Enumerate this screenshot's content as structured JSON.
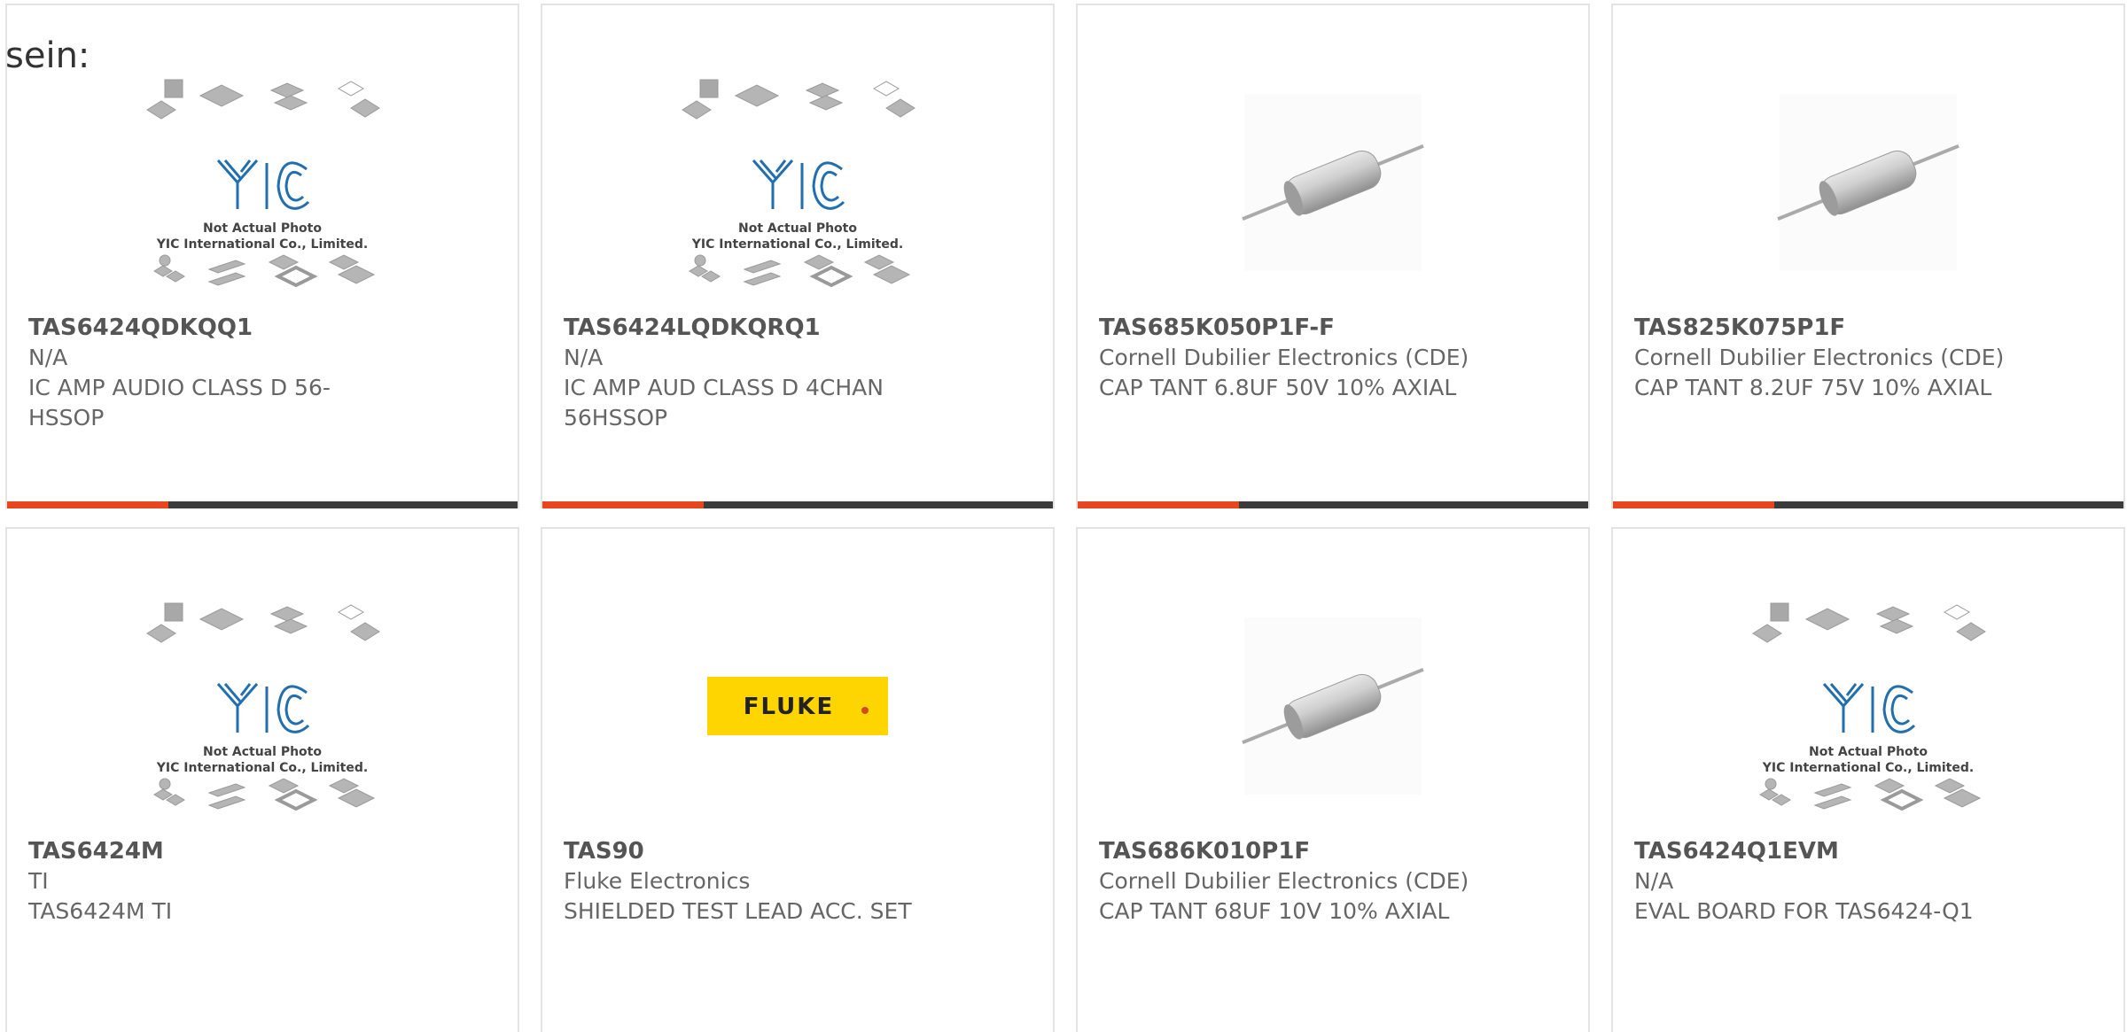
{
  "lead_text": "sein:",
  "placeholder_image": {
    "brand": "YIC",
    "line1": "Not Actual Photo",
    "line2": "YIC International Co., Limited."
  },
  "fluke_logo_text": "FLUKE",
  "products": [
    {
      "part": "TAS6424QDKQQ1",
      "manufacturer": "N/A",
      "description": "IC AMP AUDIO CLASS D 56-HSSOP",
      "image": "yic-placeholder"
    },
    {
      "part": "TAS6424LQDKQRQ1",
      "manufacturer": "N/A",
      "description": "IC AMP AUD CLASS D 4CHAN 56HSSOP",
      "image": "yic-placeholder"
    },
    {
      "part": "TAS685K050P1F-F",
      "manufacturer": "Cornell Dubilier Electronics (CDE)",
      "description": "CAP TANT 6.8UF 50V 10% AXIAL",
      "image": "axial-capacitor"
    },
    {
      "part": "TAS825K075P1F",
      "manufacturer": "Cornell Dubilier Electronics (CDE)",
      "description": "CAP TANT 8.2UF 75V 10% AXIAL",
      "image": "axial-capacitor"
    },
    {
      "part": "TAS6424M",
      "manufacturer": "TI",
      "description": "TAS6424M TI",
      "image": "yic-placeholder"
    },
    {
      "part": "TAS90",
      "manufacturer": "Fluke Electronics",
      "description": "SHIELDED TEST LEAD ACC. SET",
      "image": "fluke-logo"
    },
    {
      "part": "TAS686K010P1F",
      "manufacturer": "Cornell Dubilier Electronics (CDE)",
      "description": "CAP TANT 68UF 10V 10% AXIAL",
      "image": "axial-capacitor"
    },
    {
      "part": "TAS6424Q1EVM",
      "manufacturer": "N/A",
      "description": "EVAL BOARD FOR TAS6424-Q1",
      "image": "yic-placeholder"
    }
  ],
  "colors": {
    "accent": "#e8461e",
    "bar": "#3c3c3c",
    "border": "#e3e3e3",
    "fluke_yellow": "#ffd500"
  }
}
